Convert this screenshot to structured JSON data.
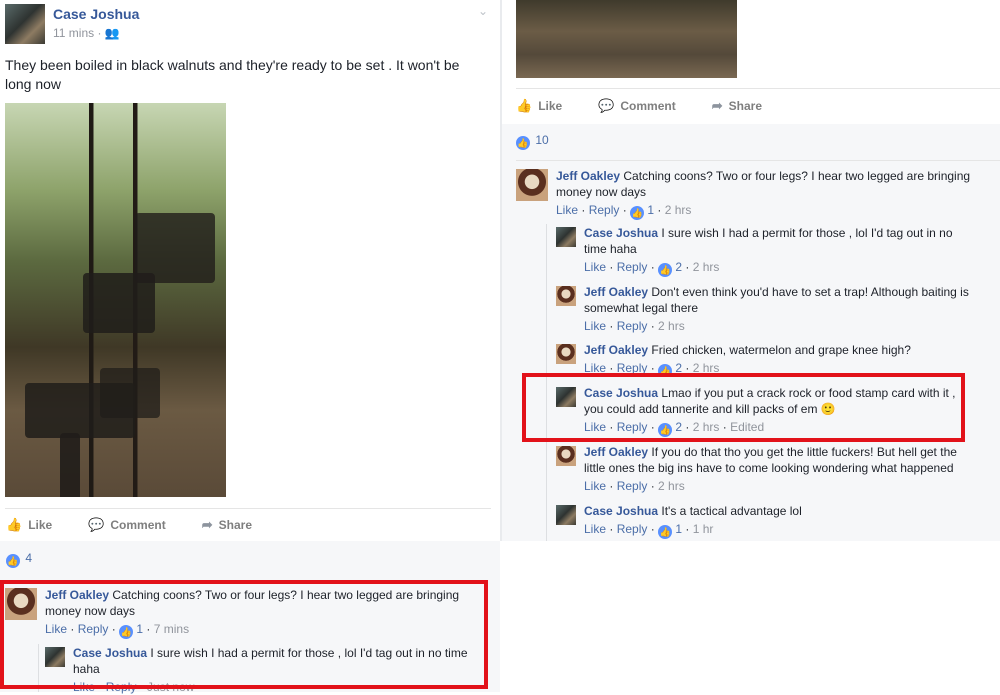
{
  "left": {
    "author": "Case Joshua",
    "time": "11 mins",
    "post_text": "They been boiled in black walnuts and they're ready to be set . It won't be long now",
    "actions": {
      "like": "Like",
      "comment": "Comment",
      "share": "Share"
    },
    "reactions_count": "4",
    "comments": [
      {
        "author": "Jeff Oakley",
        "text": "Catching coons? Two or four legs? I hear two legged are bringing money now days",
        "like": "Like",
        "reply": "Reply",
        "likes": "1",
        "time": "7 mins"
      },
      {
        "author": "Case Joshua",
        "text": "I sure wish I had a permit for those , lol I'd tag out in no time haha",
        "like": "Like",
        "reply": "Reply",
        "time": "Just now"
      }
    ]
  },
  "right": {
    "actions": {
      "like": "Like",
      "comment": "Comment",
      "share": "Share"
    },
    "reactions_count": "10",
    "comments": [
      {
        "author": "Jeff Oakley",
        "text": "Catching coons? Two or four legs? I hear two legged are bringing money now days",
        "like": "Like",
        "reply": "Reply",
        "likes": "1",
        "time": "2 hrs"
      },
      {
        "author": "Case Joshua",
        "text": "I sure wish I had a permit for those , lol I'd tag out in no time haha",
        "like": "Like",
        "reply": "Reply",
        "likes": "2",
        "time": "2 hrs"
      },
      {
        "author": "Jeff Oakley",
        "text": "Don't even think you'd have to set a trap! Although baiting is somewhat legal there",
        "like": "Like",
        "reply": "Reply",
        "time": "2 hrs"
      },
      {
        "author": "Jeff Oakley",
        "text": "Fried chicken, watermelon and grape knee high?",
        "like": "Like",
        "reply": "Reply",
        "likes": "2",
        "time": "2 hrs"
      },
      {
        "author": "Case Joshua",
        "text": "Lmao if you put a crack rock or food stamp card with it , you could add tannerite and kill packs of em",
        "emoji": "🙂",
        "like": "Like",
        "reply": "Reply",
        "likes": "2",
        "time": "2 hrs",
        "edited": "Edited"
      },
      {
        "author": "Jeff Oakley",
        "text": "If you do that tho you get the little fuckers! But hell get the little ones the big ins have to come looking wondering what happened",
        "like": "Like",
        "reply": "Reply",
        "time": "2 hrs"
      },
      {
        "author": "Case Joshua",
        "text": "It's a tactical advantage lol",
        "like": "Like",
        "reply": "Reply",
        "likes": "1",
        "time": "1 hr"
      }
    ]
  },
  "colors": {
    "accent": "#365899",
    "highlight": "#e2121a",
    "like_blue": "#5890ff"
  },
  "icons": [
    "thumb-up-icon",
    "comment-icon",
    "share-icon",
    "friends-icon",
    "chevron-down-icon",
    "like-badge-icon"
  ]
}
